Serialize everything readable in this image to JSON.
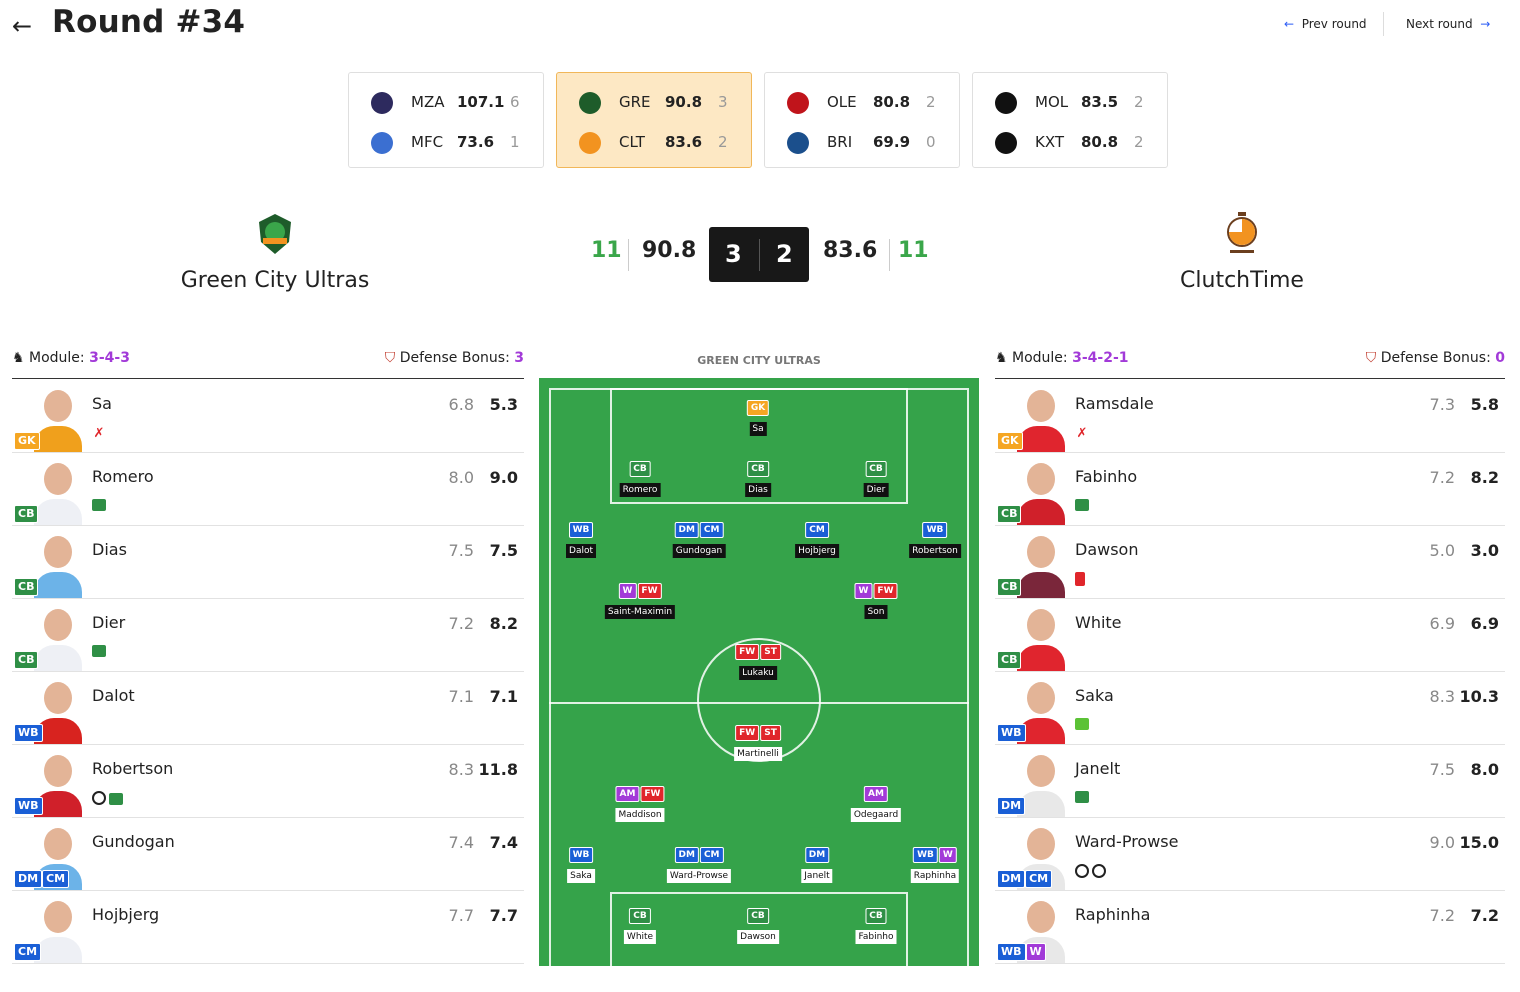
{
  "header": {
    "title": "Round #34",
    "back_icon": "←",
    "prev_label": "Prev round",
    "next_label": "Next round",
    "prev_icon": "←",
    "next_icon": "→"
  },
  "matches": [
    {
      "home": {
        "abbr": "MZA",
        "points": "107.1",
        "goals": "6",
        "logo_color": "#2d2a5e"
      },
      "away": {
        "abbr": "MFC",
        "points": "73.6",
        "goals": "1",
        "logo_color": "#3b6fd1"
      }
    },
    {
      "home": {
        "abbr": "GRE",
        "points": "90.8",
        "goals": "3",
        "logo_color": "#1e5c2a"
      },
      "away": {
        "abbr": "CLT",
        "points": "83.6",
        "goals": "2",
        "logo_color": "#f29320"
      }
    },
    {
      "home": {
        "abbr": "OLE",
        "points": "80.8",
        "goals": "2",
        "logo_color": "#c0141b"
      },
      "away": {
        "abbr": "BRI",
        "points": "69.9",
        "goals": "0",
        "logo_color": "#1b4f8c"
      }
    },
    {
      "home": {
        "abbr": "MOL",
        "points": "83.5",
        "goals": "2",
        "logo_color": "#111111"
      },
      "away": {
        "abbr": "KXT",
        "points": "80.8",
        "goals": "2",
        "logo_color": "#111111"
      }
    }
  ],
  "fixture": {
    "home": {
      "name": "Green City Ultras",
      "players": "11",
      "points": "90.8",
      "goals": "3"
    },
    "away": {
      "name": "ClutchTime",
      "players": "11",
      "points": "83.6",
      "goals": "2"
    }
  },
  "home_lineup": {
    "module_label": "Module:",
    "module": "3-4-3",
    "defense_label": "Defense Bonus:",
    "defense": "3",
    "players": [
      {
        "name": "Sa",
        "roles": [
          "GK"
        ],
        "vote": "6.8",
        "fv": "5.3",
        "shirt": "wol",
        "events": [
          "gc"
        ]
      },
      {
        "name": "Romero",
        "roles": [
          "CB"
        ],
        "vote": "8.0",
        "fv": "9.0",
        "shirt": "tot",
        "events": [
          "cs"
        ]
      },
      {
        "name": "Dias",
        "roles": [
          "CB"
        ],
        "vote": "7.5",
        "fv": "7.5",
        "shirt": "mci",
        "events": []
      },
      {
        "name": "Dier",
        "roles": [
          "CB"
        ],
        "vote": "7.2",
        "fv": "8.2",
        "shirt": "tot",
        "events": [
          "cs"
        ]
      },
      {
        "name": "Dalot",
        "roles": [
          "WB"
        ],
        "vote": "7.1",
        "fv": "7.1",
        "shirt": "mun",
        "events": []
      },
      {
        "name": "Robertson",
        "roles": [
          "WB"
        ],
        "vote": "8.3",
        "fv": "11.8",
        "shirt": "liv",
        "events": [
          "gl",
          "cs"
        ]
      },
      {
        "name": "Gundogan",
        "roles": [
          "DM",
          "CM"
        ],
        "vote": "7.4",
        "fv": "7.4",
        "shirt": "mci",
        "events": []
      },
      {
        "name": "Hojbjerg",
        "roles": [
          "CM"
        ],
        "vote": "7.7",
        "fv": "7.7",
        "shirt": "tot",
        "events": []
      }
    ]
  },
  "away_lineup": {
    "module_label": "Module:",
    "module": "3-4-2-1",
    "defense_label": "Defense Bonus:",
    "defense": "0",
    "players": [
      {
        "name": "Ramsdale",
        "roles": [
          "GK"
        ],
        "vote": "7.3",
        "fv": "5.8",
        "shirt": "ars",
        "events": [
          "gc"
        ]
      },
      {
        "name": "Fabinho",
        "roles": [
          "CB"
        ],
        "vote": "7.2",
        "fv": "8.2",
        "shirt": "liv",
        "events": [
          "cs"
        ]
      },
      {
        "name": "Dawson",
        "roles": [
          "CB"
        ],
        "vote": "5.0",
        "fv": "3.0",
        "shirt": "whu",
        "events": [
          "rc"
        ]
      },
      {
        "name": "White",
        "roles": [
          "CB"
        ],
        "vote": "6.9",
        "fv": "6.9",
        "shirt": "ars",
        "events": []
      },
      {
        "name": "Saka",
        "roles": [
          "WB"
        ],
        "vote": "8.3",
        "fv": "10.3",
        "shirt": "ars",
        "events": [
          "ast"
        ]
      },
      {
        "name": "Janelt",
        "roles": [
          "DM"
        ],
        "vote": "7.5",
        "fv": "8.0",
        "shirt": "sou",
        "events": [
          "cs"
        ]
      },
      {
        "name": "Ward-Prowse",
        "roles": [
          "DM",
          "CM"
        ],
        "vote": "9.0",
        "fv": "15.0",
        "shirt": "sou",
        "events": [
          "gl",
          "gl"
        ]
      },
      {
        "name": "Raphinha",
        "roles": [
          "WB",
          "W"
        ],
        "vote": "7.2",
        "fv": "7.2",
        "shirt": "sou",
        "events": []
      }
    ]
  },
  "pitch": {
    "caption": "GREEN CITY ULTRAS",
    "home": [
      {
        "name": "Sa",
        "roles": [
          "GK"
        ]
      },
      {
        "name": "Romero",
        "roles": [
          "CB"
        ]
      },
      {
        "name": "Dias",
        "roles": [
          "CB"
        ]
      },
      {
        "name": "Dier",
        "roles": [
          "CB"
        ]
      },
      {
        "name": "Dalot",
        "roles": [
          "WB"
        ]
      },
      {
        "name": "Gundogan",
        "roles": [
          "DM",
          "CM"
        ]
      },
      {
        "name": "Hojbjerg",
        "roles": [
          "CM"
        ]
      },
      {
        "name": "Robertson",
        "roles": [
          "WB"
        ]
      },
      {
        "name": "Saint-Maximin",
        "roles": [
          "W",
          "FW"
        ]
      },
      {
        "name": "Son",
        "roles": [
          "W",
          "FW"
        ]
      },
      {
        "name": "Lukaku",
        "roles": [
          "FW",
          "ST"
        ]
      }
    ],
    "away": [
      {
        "name": "Martinelli",
        "roles": [
          "FW",
          "ST"
        ]
      },
      {
        "name": "Maddison",
        "roles": [
          "AM",
          "FW"
        ]
      },
      {
        "name": "Odegaard",
        "roles": [
          "AM"
        ]
      },
      {
        "name": "Saka",
        "roles": [
          "WB"
        ]
      },
      {
        "name": "Ward-Prowse",
        "roles": [
          "DM",
          "CM"
        ]
      },
      {
        "name": "Janelt",
        "roles": [
          "DM"
        ]
      },
      {
        "name": "Raphinha",
        "roles": [
          "WB",
          "W"
        ]
      },
      {
        "name": "White",
        "roles": [
          "CB"
        ]
      },
      {
        "name": "Dawson",
        "roles": [
          "CB"
        ]
      },
      {
        "name": "Fabinho",
        "roles": [
          "CB"
        ]
      }
    ]
  }
}
